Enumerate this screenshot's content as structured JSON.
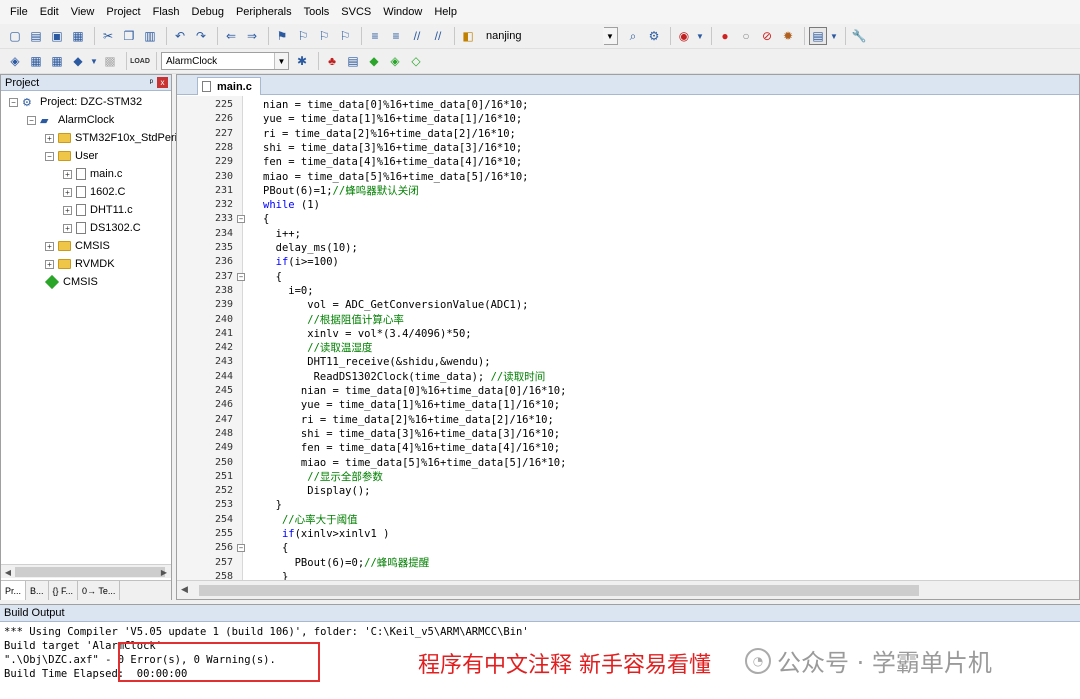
{
  "menu": [
    "File",
    "Edit",
    "View",
    "Project",
    "Flash",
    "Debug",
    "Peripherals",
    "Tools",
    "SVCS",
    "Window",
    "Help"
  ],
  "toolbar1": {
    "search_target": "nanjing"
  },
  "toolbar2": {
    "target_select": "AlarmClock",
    "load_label": "LOAD"
  },
  "project_panel": {
    "title": "Project",
    "pin": "ᵖ",
    "close": "x",
    "tree": [
      {
        "label": "Project: DZC-STM32",
        "level": 0,
        "icon": "project-icon",
        "exp": "−"
      },
      {
        "label": "AlarmClock",
        "level": 1,
        "icon": "target-icon",
        "exp": "−"
      },
      {
        "label": "STM32F10x_StdPeriph",
        "level": 2,
        "icon": "folder-icon",
        "exp": "+"
      },
      {
        "label": "User",
        "level": 2,
        "icon": "folder-icon",
        "exp": "−"
      },
      {
        "label": "main.c",
        "level": 3,
        "icon": "file-icon",
        "exp": "+"
      },
      {
        "label": "1602.C",
        "level": 3,
        "icon": "file-icon",
        "exp": "+"
      },
      {
        "label": "DHT11.c",
        "level": 3,
        "icon": "file-icon",
        "exp": "+"
      },
      {
        "label": "DS1302.C",
        "level": 3,
        "icon": "file-icon",
        "exp": "+"
      },
      {
        "label": "CMSIS",
        "level": 2,
        "icon": "folder-icon",
        "exp": "+"
      },
      {
        "label": "RVMDK",
        "level": 2,
        "icon": "folder-icon",
        "exp": "+"
      },
      {
        "label": "CMSIS",
        "level": 2,
        "icon": "diamond-icon",
        "exp": ""
      }
    ],
    "tabs": [
      "Pr...",
      "B...",
      "{} F...",
      "0→ Te..."
    ]
  },
  "editor": {
    "tab": "main.c",
    "lines": [
      {
        "n": "225",
        "f": "",
        "t": "nian = time_data[0]%16+time_data[0]/16*10;"
      },
      {
        "n": "226",
        "f": "",
        "t": "yue = time_data[1]%16+time_data[1]/16*10;"
      },
      {
        "n": "227",
        "f": "",
        "t": "ri = time_data[2]%16+time_data[2]/16*10;"
      },
      {
        "n": "228",
        "f": "",
        "t": "shi = time_data[3]%16+time_data[3]/16*10;"
      },
      {
        "n": "229",
        "f": "",
        "t": "fen = time_data[4]%16+time_data[4]/16*10;"
      },
      {
        "n": "230",
        "f": "",
        "t": "miao = time_data[5]%16+time_data[5]/16*10;"
      },
      {
        "n": "231",
        "f": "",
        "t": "PBout(6)=1;",
        "c": "//蜂鸣器默认关闭"
      },
      {
        "n": "232",
        "f": "",
        "k": "while",
        "t": " (1)"
      },
      {
        "n": "233",
        "f": "−",
        "t": "{"
      },
      {
        "n": "234",
        "f": "",
        "t": "  i++;"
      },
      {
        "n": "235",
        "f": "",
        "t": "  delay_ms(10);"
      },
      {
        "n": "236",
        "f": "",
        "k": "  if",
        "t": "(i>=100)"
      },
      {
        "n": "237",
        "f": "−",
        "t": "  {"
      },
      {
        "n": "238",
        "f": "",
        "t": "    i=0;"
      },
      {
        "n": "239",
        "f": "",
        "t": "       vol = ADC_GetConversionValue(ADC1);"
      },
      {
        "n": "240",
        "f": "",
        "t": "       ",
        "c": "//根据阻值计算心率"
      },
      {
        "n": "241",
        "f": "",
        "t": "       xinlv = vol*(3.4/4096)*50;"
      },
      {
        "n": "242",
        "f": "",
        "t": "       ",
        "c": "//读取温湿度"
      },
      {
        "n": "243",
        "f": "",
        "t": "       DHT11_receive(&shidu,&wendu);"
      },
      {
        "n": "244",
        "f": "",
        "t": "        ReadDS1302Clock(time_data); ",
        "c": "//读取时间"
      },
      {
        "n": "245",
        "f": "",
        "t": "      nian = time_data[0]%16+time_data[0]/16*10;"
      },
      {
        "n": "246",
        "f": "",
        "t": "      yue = time_data[1]%16+time_data[1]/16*10;"
      },
      {
        "n": "247",
        "f": "",
        "t": "      ri = time_data[2]%16+time_data[2]/16*10;"
      },
      {
        "n": "248",
        "f": "",
        "t": "      shi = time_data[3]%16+time_data[3]/16*10;"
      },
      {
        "n": "249",
        "f": "",
        "t": "      fen = time_data[4]%16+time_data[4]/16*10;"
      },
      {
        "n": "250",
        "f": "",
        "t": "      miao = time_data[5]%16+time_data[5]/16*10;"
      },
      {
        "n": "251",
        "f": "",
        "t": "       ",
        "c": "//显示全部参数"
      },
      {
        "n": "252",
        "f": "",
        "t": "       Display();"
      },
      {
        "n": "253",
        "f": "",
        "t": "  }"
      },
      {
        "n": "254",
        "f": "",
        "t": "   ",
        "c": "//心率大于阈值"
      },
      {
        "n": "255",
        "f": "",
        "k": "   if",
        "t": "(xinlv>xinlv1 )"
      },
      {
        "n": "256",
        "f": "−",
        "t": "   {"
      },
      {
        "n": "257",
        "f": "",
        "t": "     PBout(6)=0;",
        "c": "//蜂鸣器提醒"
      },
      {
        "n": "258",
        "f": "",
        "t": "   }"
      }
    ]
  },
  "build_output": {
    "title": "Build Output",
    "lines": [
      "*** Using Compiler 'V5.05 update 1 (build 106)', folder: 'C:\\Keil_v5\\ARM\\ARMCC\\Bin'",
      "Build target 'AlarmClock'",
      "\".\\Obj\\DZC.axf\" - 0 Error(s), 0 Warning(s).",
      "Build Time Elapsed:  00:00:00"
    ]
  },
  "annotation": "程序有中文注释 新手容易看懂",
  "watermark": "公众号 · 学霸单片机",
  "colors": {
    "keyword": "#0000ff",
    "comment": "#008000",
    "annotation": "#e02020",
    "highlight_box": "#e03030"
  }
}
